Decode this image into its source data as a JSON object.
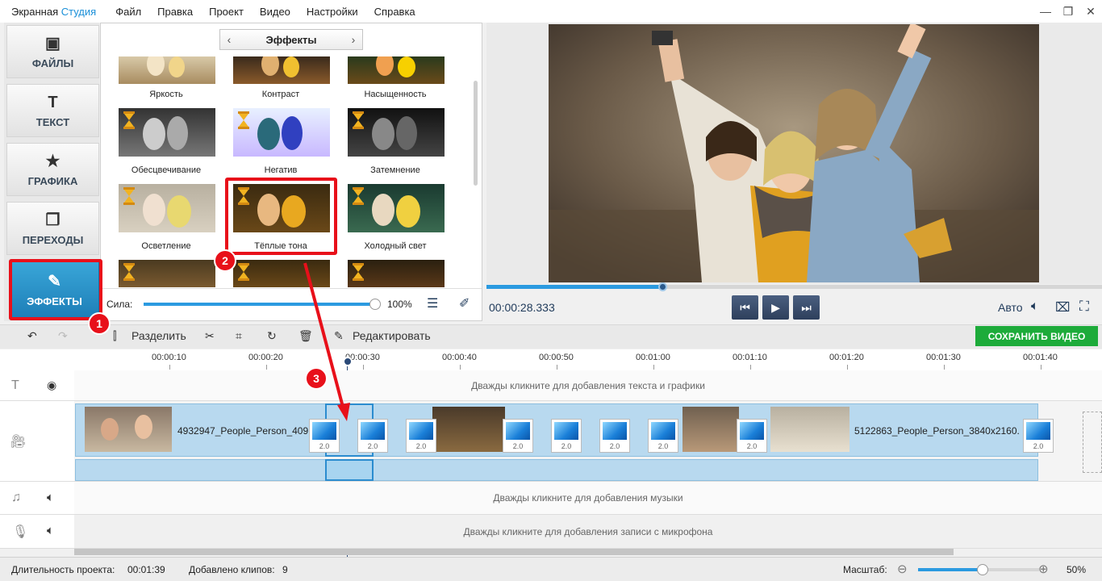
{
  "app": {
    "brand_part1": "Экранная",
    "brand_part2": "Студия"
  },
  "menu": [
    "Файл",
    "Правка",
    "Проект",
    "Видео",
    "Настройки",
    "Справка"
  ],
  "nav": [
    {
      "label": "ФАЙЛЫ",
      "icon": "image-icon"
    },
    {
      "label": "ТЕКСТ",
      "icon": "text-icon"
    },
    {
      "label": "ГРАФИКА",
      "icon": "star-icon"
    },
    {
      "label": "ПЕРЕХОДЫ",
      "icon": "transitions-icon"
    },
    {
      "label": "ЭФФЕКТЫ",
      "icon": "effects-icon",
      "active": true
    }
  ],
  "effects": {
    "title": "Эффекты",
    "items": [
      "Яркость",
      "Контраст",
      "Насыщенность",
      "Обесцвечивание",
      "Негатив",
      "Затемнение",
      "Осветление",
      "Тёплые тона",
      "Холодный свет"
    ],
    "strength_label": "Сила:",
    "strength_value": "100%",
    "strength_fraction": 1.0
  },
  "player": {
    "time": "00:00:28.333",
    "auto_label": "Авто",
    "progress_fraction": 0.287
  },
  "toolbar": {
    "split": "Разделить",
    "edit": "Редактировать",
    "save": "СОХРАНИТЬ ВИДЕО"
  },
  "ruler": [
    "00:00:10",
    "00:00:20",
    "00:00:30",
    "00:00:40",
    "00:00:50",
    "00:01:00",
    "00:01:10",
    "00:01:20",
    "00:01:30",
    "00:01:40"
  ],
  "tracks": {
    "text_hint": "Дважды кликните для добавления текста и графики",
    "music_hint": "Дважды кликните для добавления музыки",
    "mic_hint": "Дважды кликните для добавления записи с микрофона",
    "clip1": "4932947_People_Person_409",
    "clip2": "5122863_People_Person_3840x2160.",
    "transition_duration": "2.0"
  },
  "status": {
    "duration_label": "Длительность проекта:",
    "duration_value": "00:01:39",
    "clips_label": "Добавлено клипов:",
    "clips_value": "9",
    "zoom_label": "Масштаб:",
    "zoom_value": "50%",
    "zoom_fraction": 0.5
  },
  "callouts": [
    "1",
    "2",
    "3"
  ],
  "colors": {
    "accent": "#2b9ae0",
    "save": "#1dab3a",
    "callout": "#e8101a"
  }
}
